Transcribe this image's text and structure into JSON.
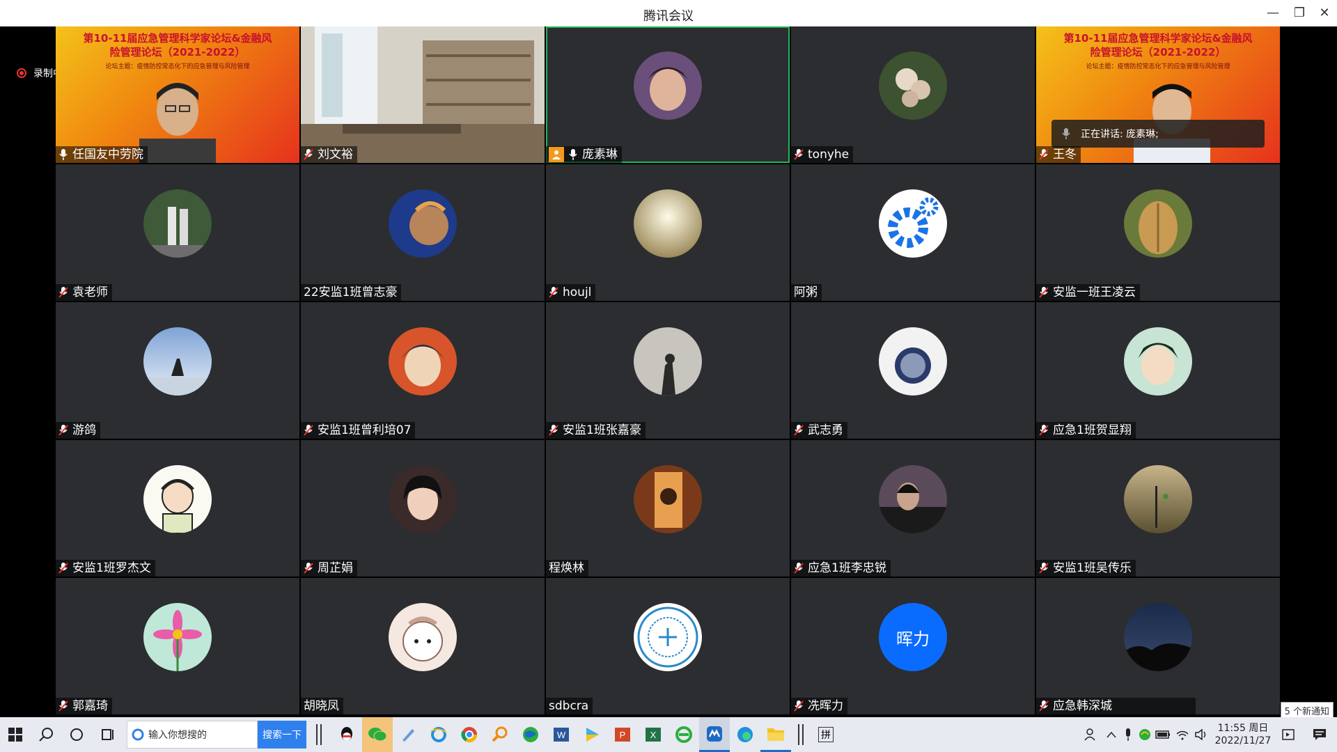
{
  "window": {
    "title": "腾讯会议"
  },
  "recording": {
    "label": "录制中"
  },
  "speaking": {
    "text": "正在讲话: 庞素琳;"
  },
  "banner": {
    "line1": "第10-11届应急管理科学家论坛&金融风",
    "line2": "险管理论坛（2021-2022）",
    "line3": "论坛主题：疫情防控常态化下的应急管理与风险管理"
  },
  "participants": [
    {
      "name": "任国友中劳院"
    },
    {
      "name": "刘文裕"
    },
    {
      "name": "庞素琳"
    },
    {
      "name": "tonyhe"
    },
    {
      "name": "王冬"
    },
    {
      "name": "袁老师"
    },
    {
      "name": "22安监1班曾志豪"
    },
    {
      "name": "houjl"
    },
    {
      "name": "阿粥"
    },
    {
      "name": "安监一班王凌云"
    },
    {
      "name": "游鸽"
    },
    {
      "name": "安监1班曾利培07"
    },
    {
      "name": "安监1班张嘉豪"
    },
    {
      "name": "武志勇"
    },
    {
      "name": "应急1班贺显翔"
    },
    {
      "name": "安监1班罗杰文"
    },
    {
      "name": "周芷娟"
    },
    {
      "name": "程焕林"
    },
    {
      "name": "应急1班李忠锐"
    },
    {
      "name": "安监1班吴传乐"
    },
    {
      "name": "郭嘉琦"
    },
    {
      "name": "胡晓凤"
    },
    {
      "name": "sdbcra"
    },
    {
      "name": "冼晖力",
      "avatar_text": "晖力"
    },
    {
      "name": "应急韩深城"
    }
  ],
  "notification": {
    "text": "5 个新通知"
  },
  "taskbar": {
    "search_placeholder": "输入你想搜的",
    "search_button": "搜索一下",
    "ime": "拼",
    "time": "11:55 周日",
    "date": "2022/11/27"
  }
}
